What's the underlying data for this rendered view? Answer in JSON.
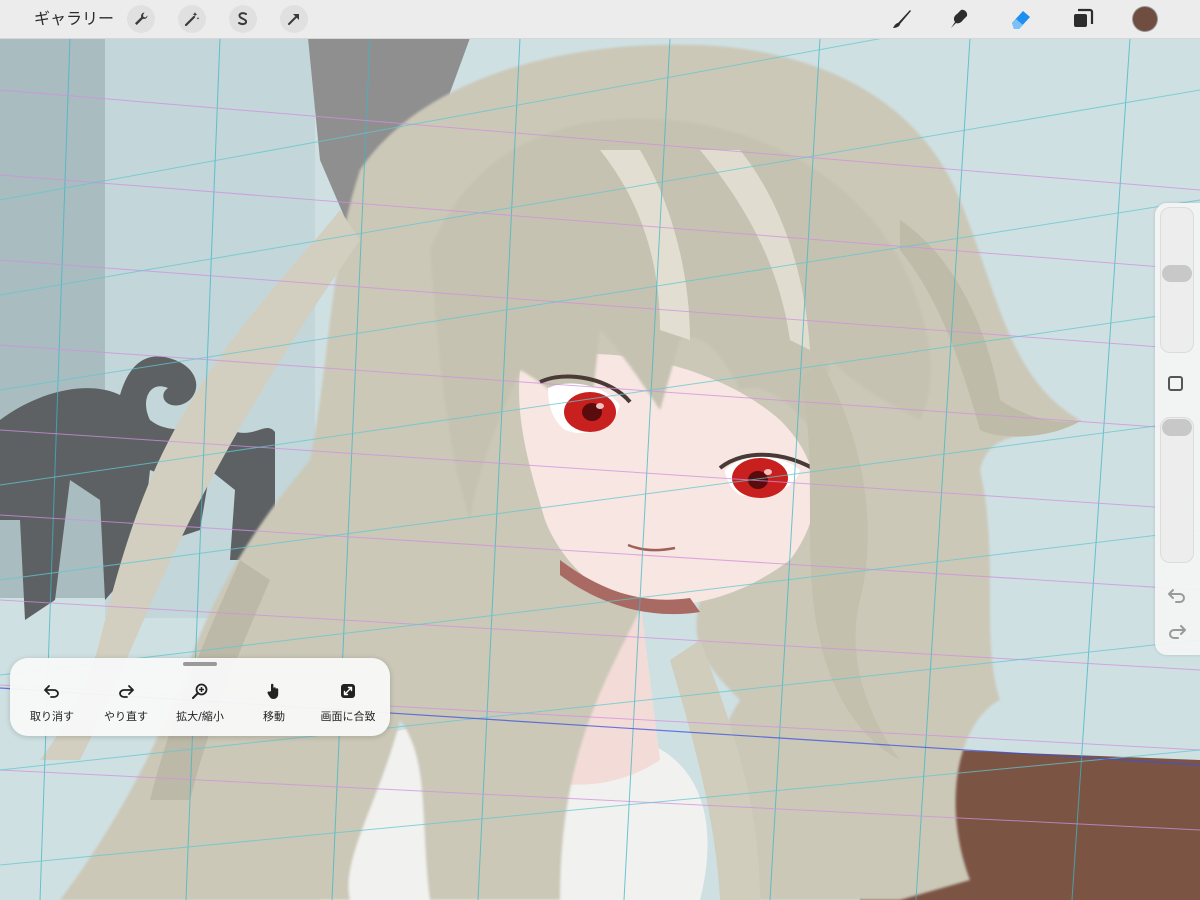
{
  "top_bar": {
    "gallery_label": "ギャラリー",
    "left_tools": [
      {
        "name": "actions-icon"
      },
      {
        "name": "adjustments-icon"
      },
      {
        "name": "selection-icon"
      },
      {
        "name": "transform-icon"
      }
    ],
    "right_tools": [
      {
        "name": "brush-icon"
      },
      {
        "name": "smudge-icon"
      },
      {
        "name": "eraser-icon",
        "active": true,
        "active_color": "#1f8ef1"
      },
      {
        "name": "layers-icon"
      }
    ],
    "current_color": "#6f4e41"
  },
  "sidebar": {
    "brush_size_level": 0.45,
    "opacity_level": 0.0
  },
  "quick_menu": {
    "items": [
      {
        "label": "取り消す",
        "icon": "undo-icon"
      },
      {
        "label": "やり直す",
        "icon": "redo-icon"
      },
      {
        "label": "拡大/縮小",
        "icon": "zoom-icon"
      },
      {
        "label": "移動",
        "icon": "hand-icon"
      },
      {
        "label": "画面に合致",
        "icon": "fit-screen-icon"
      }
    ]
  },
  "colors": {
    "hair": "#cbc8b8",
    "skin": "#f5dfdc",
    "eyes": "#c8201f",
    "table": "#7c5444",
    "wall": "#cfe0e3"
  }
}
